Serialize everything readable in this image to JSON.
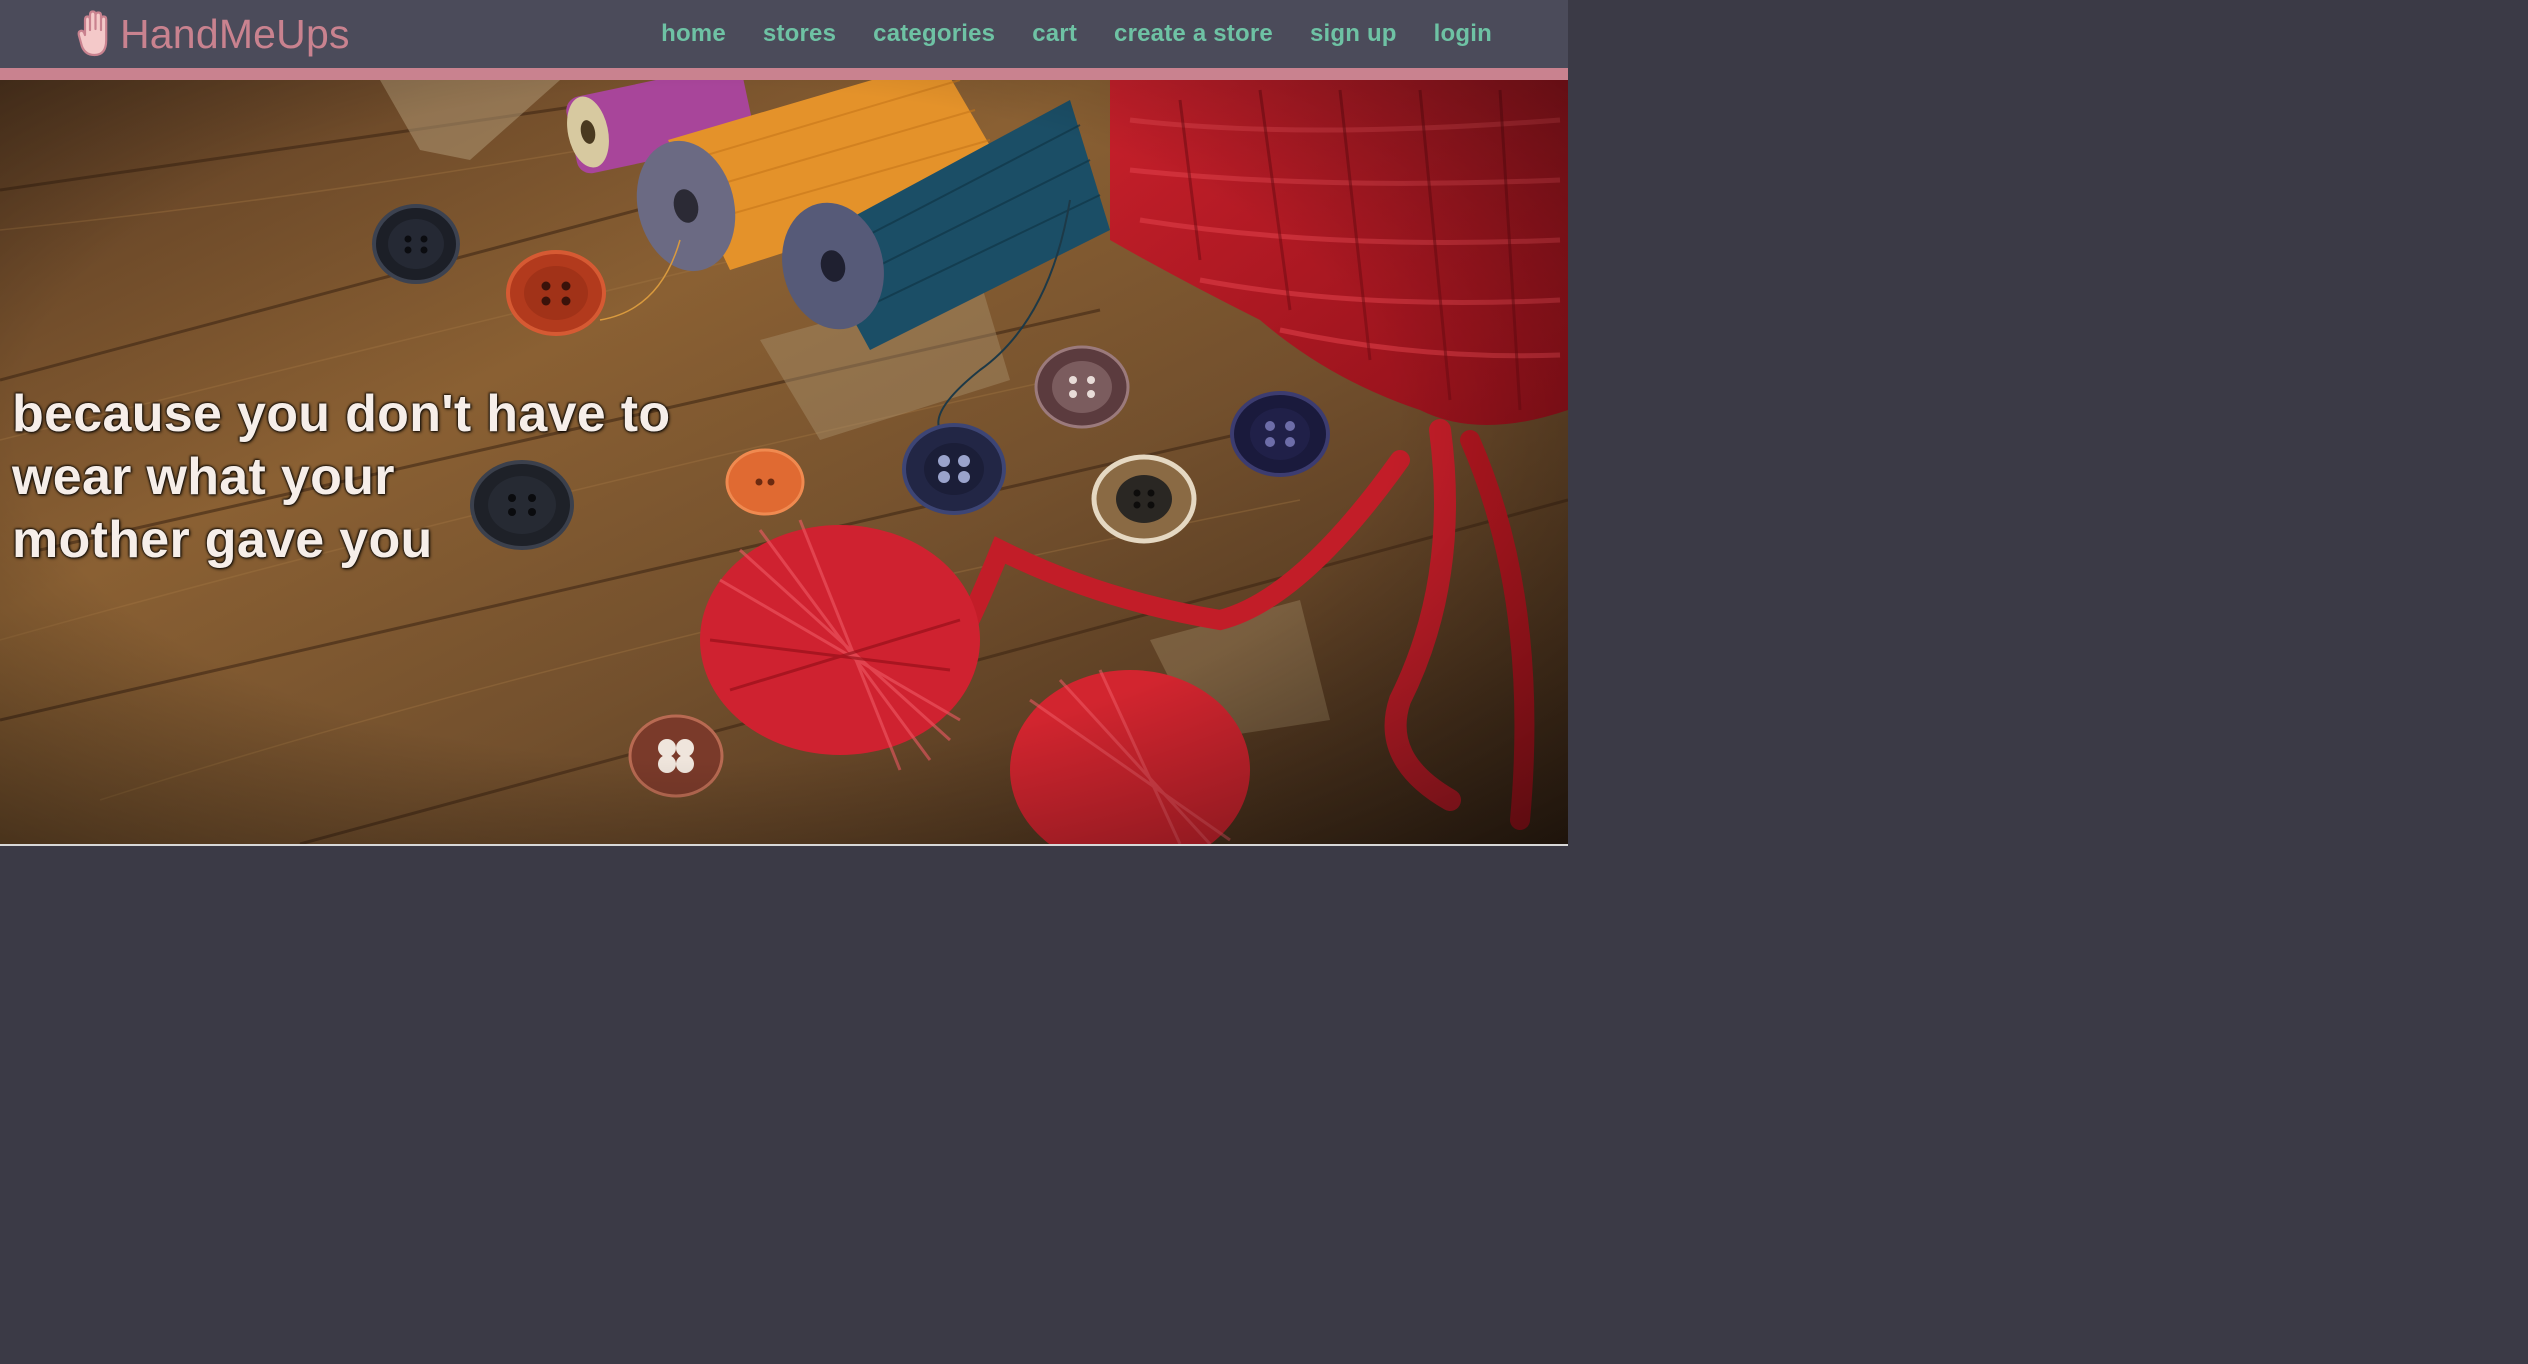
{
  "brand": {
    "name": "HandMeUps",
    "logo_icon": "hand-icon"
  },
  "nav": {
    "items": [
      {
        "label": "home"
      },
      {
        "label": "stores"
      },
      {
        "label": "categories"
      },
      {
        "label": "cart"
      },
      {
        "label": "create a store"
      },
      {
        "label": "sign up"
      },
      {
        "label": "login"
      }
    ]
  },
  "hero": {
    "tagline_lines": [
      "because you don't have to",
      "wear what your",
      "mother gave you"
    ],
    "image": "sewing-supplies-photo"
  },
  "colors": {
    "navbar": "#4b4b5a",
    "accent_pink": "#c9828f",
    "link_green": "#6ec2a4",
    "tagline_text": "#f6eee9"
  }
}
